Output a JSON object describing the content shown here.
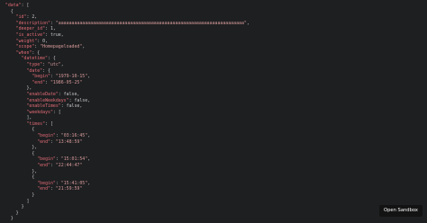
{
  "code": {
    "lines": [
      {
        "indent": 2,
        "parts": [
          [
            "key",
            "\"data\""
          ],
          [
            "punc",
            ": ["
          ]
        ]
      },
      {
        "indent": 4,
        "parts": [
          [
            "punc",
            "{"
          ]
        ]
      },
      {
        "indent": 6,
        "parts": [
          [
            "key",
            "\"id\""
          ],
          [
            "punc",
            ": 2,"
          ]
        ]
      },
      {
        "indent": 6,
        "parts": [
          [
            "key",
            "\"description\""
          ],
          [
            "punc",
            ": "
          ],
          [
            "str",
            "\"aaaaaaaaaaaaaaaaaaaaaaaaaaaaaaaaaaaaaaaaaaaaaaaaaaaaaaaaaaaaaaaaaaaaaa\""
          ],
          [
            "punc",
            ","
          ]
        ]
      },
      {
        "indent": 6,
        "parts": [
          [
            "key",
            "\"deeper_id\""
          ],
          [
            "punc",
            ": 1,"
          ]
        ]
      },
      {
        "indent": 6,
        "parts": [
          [
            "key",
            "\"is_active\""
          ],
          [
            "punc",
            ": true,"
          ]
        ]
      },
      {
        "indent": 6,
        "parts": [
          [
            "key",
            "\"weight\""
          ],
          [
            "punc",
            ": 0,"
          ]
        ]
      },
      {
        "indent": 6,
        "parts": [
          [
            "key",
            "\"scope\""
          ],
          [
            "punc",
            ": "
          ],
          [
            "str",
            "\"Homepageloaded\""
          ],
          [
            "punc",
            ","
          ]
        ]
      },
      {
        "indent": 6,
        "parts": [
          [
            "key",
            "\"when\""
          ],
          [
            "punc",
            ": {"
          ]
        ]
      },
      {
        "indent": 8,
        "parts": [
          [
            "key",
            "\"datetime\""
          ],
          [
            "punc",
            ": {"
          ]
        ]
      },
      {
        "indent": 10,
        "parts": [
          [
            "key",
            "\"type\""
          ],
          [
            "punc",
            ": "
          ],
          [
            "str",
            "\"utc\""
          ],
          [
            "punc",
            ","
          ]
        ]
      },
      {
        "indent": 10,
        "parts": [
          [
            "key",
            "\"date\""
          ],
          [
            "punc",
            ": {"
          ]
        ]
      },
      {
        "indent": 12,
        "parts": [
          [
            "key",
            "\"begin\""
          ],
          [
            "punc",
            ": "
          ],
          [
            "str",
            "\"1979-10-15\""
          ],
          [
            "punc",
            ","
          ]
        ]
      },
      {
        "indent": 12,
        "parts": [
          [
            "key",
            "\"end\""
          ],
          [
            "punc",
            ": "
          ],
          [
            "str",
            "\"1986-05-25\""
          ]
        ]
      },
      {
        "indent": 10,
        "parts": [
          [
            "punc",
            "},"
          ]
        ]
      },
      {
        "indent": 10,
        "parts": [
          [
            "key",
            "\"enableDate\""
          ],
          [
            "punc",
            ": false,"
          ]
        ]
      },
      {
        "indent": 10,
        "parts": [
          [
            "key",
            "\"enableWeekdays\""
          ],
          [
            "punc",
            ": false,"
          ]
        ]
      },
      {
        "indent": 10,
        "parts": [
          [
            "key",
            "\"enableTimes\""
          ],
          [
            "punc",
            ": false,"
          ]
        ]
      },
      {
        "indent": 10,
        "parts": [
          [
            "key",
            "\"weekdays\""
          ],
          [
            "punc",
            ": ["
          ]
        ]
      },
      {
        "indent": 10,
        "parts": [
          [
            "punc",
            "],"
          ]
        ]
      },
      {
        "indent": 10,
        "parts": [
          [
            "key",
            "\"times\""
          ],
          [
            "punc",
            ": ["
          ]
        ]
      },
      {
        "indent": 12,
        "parts": [
          [
            "punc",
            "{"
          ]
        ]
      },
      {
        "indent": 14,
        "parts": [
          [
            "key",
            "\"begin\""
          ],
          [
            "punc",
            ": "
          ],
          [
            "str",
            "\"03:16:45\""
          ],
          [
            "punc",
            ","
          ]
        ]
      },
      {
        "indent": 14,
        "parts": [
          [
            "key",
            "\"end\""
          ],
          [
            "punc",
            ": "
          ],
          [
            "str",
            "\"13:48:59\""
          ]
        ]
      },
      {
        "indent": 12,
        "parts": [
          [
            "punc",
            "},"
          ]
        ]
      },
      {
        "indent": 12,
        "parts": [
          [
            "punc",
            "{"
          ]
        ]
      },
      {
        "indent": 14,
        "parts": [
          [
            "key",
            "\"begin\""
          ],
          [
            "punc",
            ": "
          ],
          [
            "str",
            "\"15:01:54\""
          ],
          [
            "punc",
            ","
          ]
        ]
      },
      {
        "indent": 14,
        "parts": [
          [
            "key",
            "\"end\""
          ],
          [
            "punc",
            ": "
          ],
          [
            "str",
            "\"22:44:47\""
          ]
        ]
      },
      {
        "indent": 12,
        "parts": [
          [
            "punc",
            "},"
          ]
        ]
      },
      {
        "indent": 12,
        "parts": [
          [
            "punc",
            "{"
          ]
        ]
      },
      {
        "indent": 14,
        "parts": [
          [
            "key",
            "\"begin\""
          ],
          [
            "punc",
            ": "
          ],
          [
            "str",
            "\"15:41:05\""
          ],
          [
            "punc",
            ","
          ]
        ]
      },
      {
        "indent": 14,
        "parts": [
          [
            "key",
            "\"end\""
          ],
          [
            "punc",
            ": "
          ],
          [
            "str",
            "\"21:59:59\""
          ]
        ]
      },
      {
        "indent": 12,
        "parts": [
          [
            "punc",
            "}"
          ]
        ]
      },
      {
        "indent": 10,
        "parts": [
          [
            "punc",
            "]"
          ]
        ]
      },
      {
        "indent": 8,
        "parts": [
          [
            "punc",
            "}"
          ]
        ]
      },
      {
        "indent": 6,
        "parts": [
          [
            "punc",
            "}"
          ]
        ]
      },
      {
        "indent": 4,
        "parts": [
          [
            "punc",
            "}"
          ]
        ]
      }
    ]
  },
  "sandbox_button": {
    "label": "Open Sandbox"
  }
}
